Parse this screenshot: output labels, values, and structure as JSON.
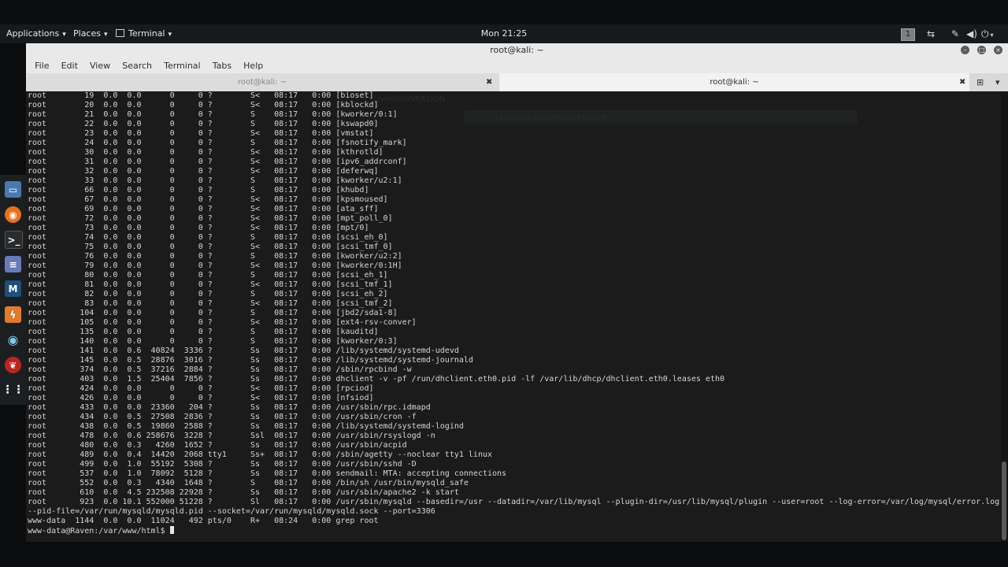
{
  "topbar": {
    "applications": "Applications",
    "places": "Places",
    "terminal": "Terminal",
    "clock": "Mon 21:25",
    "workspace": "1"
  },
  "window": {
    "title": "root@kali: ~",
    "menu": [
      "File",
      "Edit",
      "View",
      "Search",
      "Terminal",
      "Tabs",
      "Help"
    ],
    "tabs": [
      {
        "label": "root@kali: ~",
        "active": false
      },
      {
        "label": "root@kali: ~",
        "active": true
      }
    ]
  },
  "background": {
    "tab_text": "/vendor/VERSION",
    "url_text": "raven.local/vendor/VERSION"
  },
  "icons": {
    "dock": [
      "files-icon",
      "firefox-icon",
      "terminal-icon",
      "text-editor-icon",
      "metasploit-icon",
      "burpsuite-icon",
      "eye-icon",
      "cherrytree-icon",
      "show-apps-icon"
    ],
    "tray": [
      "network-icon",
      "pen-icon",
      "volume-icon",
      "power-icon"
    ]
  },
  "colors": {
    "terminal_bg": "#1b1b1b",
    "terminal_fg": "#d6d6d6",
    "topbar_bg": "#171a1c",
    "chrome_bg": "#e9e9e9"
  },
  "terminal": {
    "lines": [
      "root        19  0.0  0.0      0     0 ?        S<   08:17   0:00 [bioset]",
      "root        20  0.0  0.0      0     0 ?        S<   08:17   0:00 [kblockd]",
      "root        21  0.0  0.0      0     0 ?        S    08:17   0:00 [kworker/0:1]",
      "root        22  0.0  0.0      0     0 ?        S    08:17   0:00 [kswapd0]",
      "root        23  0.0  0.0      0     0 ?        S<   08:17   0:00 [vmstat]",
      "root        24  0.0  0.0      0     0 ?        S    08:17   0:00 [fsnotify_mark]",
      "root        30  0.0  0.0      0     0 ?        S<   08:17   0:00 [kthrotld]",
      "root        31  0.0  0.0      0     0 ?        S<   08:17   0:00 [ipv6_addrconf]",
      "root        32  0.0  0.0      0     0 ?        S<   08:17   0:00 [deferwq]",
      "root        33  0.0  0.0      0     0 ?        S    08:17   0:00 [kworker/u2:1]",
      "root        66  0.0  0.0      0     0 ?        S    08:17   0:00 [khubd]",
      "root        67  0.0  0.0      0     0 ?        S<   08:17   0:00 [kpsmoused]",
      "root        69  0.0  0.0      0     0 ?        S<   08:17   0:00 [ata_sff]",
      "root        72  0.0  0.0      0     0 ?        S<   08:17   0:00 [mpt_poll_0]",
      "root        73  0.0  0.0      0     0 ?        S<   08:17   0:00 [mpt/0]",
      "root        74  0.0  0.0      0     0 ?        S    08:17   0:00 [scsi_eh_0]",
      "root        75  0.0  0.0      0     0 ?        S<   08:17   0:00 [scsi_tmf_0]",
      "root        76  0.0  0.0      0     0 ?        S    08:17   0:00 [kworker/u2:2]",
      "root        79  0.0  0.0      0     0 ?        S<   08:17   0:00 [kworker/0:1H]",
      "root        80  0.0  0.0      0     0 ?        S    08:17   0:00 [scsi_eh_1]",
      "root        81  0.0  0.0      0     0 ?        S<   08:17   0:00 [scsi_tmf_1]",
      "root        82  0.0  0.0      0     0 ?        S    08:17   0:00 [scsi_eh_2]",
      "root        83  0.0  0.0      0     0 ?        S<   08:17   0:00 [scsi_tmf_2]",
      "root       104  0.0  0.0      0     0 ?        S    08:17   0:00 [jbd2/sda1-8]",
      "root       105  0.0  0.0      0     0 ?        S<   08:17   0:00 [ext4-rsv-conver]",
      "root       135  0.0  0.0      0     0 ?        S    08:17   0:00 [kauditd]",
      "root       140  0.0  0.0      0     0 ?        S    08:17   0:00 [kworker/0:3]",
      "root       141  0.0  0.6  40824  3336 ?        Ss   08:17   0:00 /lib/systemd/systemd-udevd",
      "root       145  0.0  0.5  28876  3016 ?        Ss   08:17   0:00 /lib/systemd/systemd-journald",
      "root       374  0.0  0.5  37216  2884 ?        Ss   08:17   0:00 /sbin/rpcbind -w",
      "root       403  0.0  1.5  25404  7856 ?        Ss   08:17   0:00 dhclient -v -pf /run/dhclient.eth0.pid -lf /var/lib/dhcp/dhclient.eth0.leases eth0",
      "root       424  0.0  0.0      0     0 ?        S<   08:17   0:00 [rpciod]",
      "root       426  0.0  0.0      0     0 ?        S<   08:17   0:00 [nfsiod]",
      "root       433  0.0  0.0  23360   204 ?        Ss   08:17   0:00 /usr/sbin/rpc.idmapd",
      "root       434  0.0  0.5  27508  2836 ?        Ss   08:17   0:00 /usr/sbin/cron -f",
      "root       438  0.0  0.5  19860  2588 ?        Ss   08:17   0:00 /lib/systemd/systemd-logind",
      "root       478  0.0  0.6 258676  3228 ?        Ssl  08:17   0:00 /usr/sbin/rsyslogd -n",
      "root       480  0.0  0.3   4260  1652 ?        Ss   08:17   0:00 /usr/sbin/acpid",
      "root       489  0.0  0.4  14420  2068 tty1     Ss+  08:17   0:00 /sbin/agetty --noclear tty1 linux",
      "root       499  0.0  1.0  55192  5308 ?        Ss   08:17   0:00 /usr/sbin/sshd -D",
      "root       537  0.0  1.0  78092  5128 ?        Ss   08:17   0:00 sendmail: MTA: accepting connections",
      "root       552  0.0  0.3   4340  1648 ?        S    08:17   0:00 /bin/sh /usr/bin/mysqld_safe",
      "root       610  0.0  4.5 232508 22928 ?        Ss   08:17   0:00 /usr/sbin/apache2 -k start",
      "root       923  0.0 10.1 552000 51228 ?        Sl   08:17   0:00 /usr/sbin/mysqld --basedir=/usr --datadir=/var/lib/mysql --plugin-dir=/usr/lib/mysql/plugin --user=root --log-error=/var/log/mysql/error.log",
      "--pid-file=/var/run/mysqld/mysqld.pid --socket=/var/run/mysqld/mysqld.sock --port=3306",
      "www-data  1144  0.0  0.0  11024   492 pts/0    R+   08:24   0:00 grep root"
    ],
    "prompt": "www-data@Raven:/var/www/html$ "
  }
}
